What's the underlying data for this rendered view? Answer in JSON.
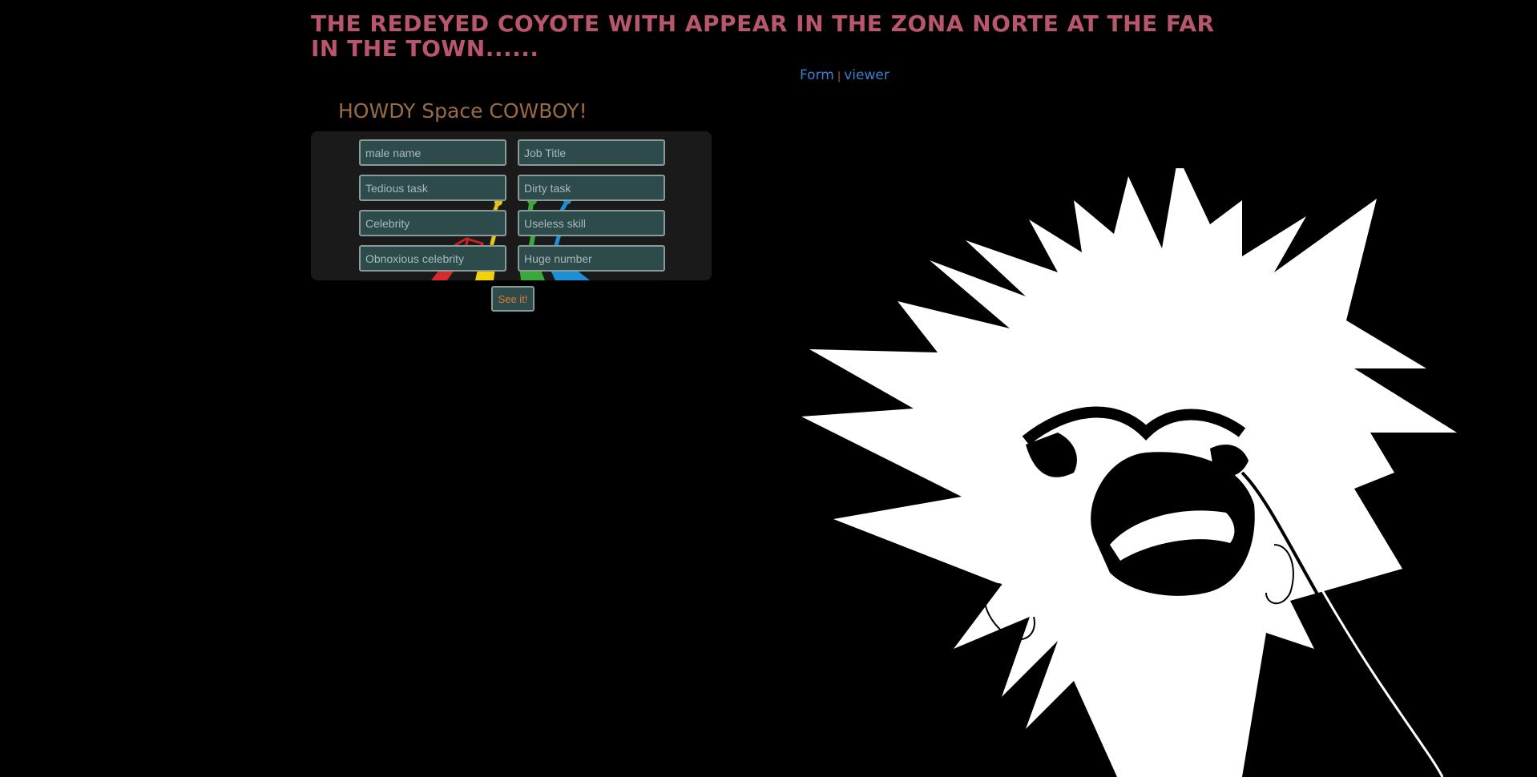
{
  "header": {
    "headline": "THE REDEYED COYOTE WITH APPEAR IN THE ZONA NORTE AT THE FAR IN THE TOWN......"
  },
  "nav": {
    "form_label": "Form",
    "separator": "|",
    "viewer_label": "viewer"
  },
  "main": {
    "greeting": "HOWDY Space COWBOY!"
  },
  "form": {
    "fields": [
      {
        "placeholder": "male name",
        "value": ""
      },
      {
        "placeholder": "Job Title",
        "value": ""
      },
      {
        "placeholder": "Tedious task",
        "value": ""
      },
      {
        "placeholder": "Dirty task",
        "value": ""
      },
      {
        "placeholder": "Celebrity",
        "value": ""
      },
      {
        "placeholder": "Useless skill",
        "value": ""
      },
      {
        "placeholder": "Obnoxious celebrity",
        "value": ""
      },
      {
        "placeholder": "Huge number",
        "value": ""
      }
    ],
    "submit_label": "See it!"
  },
  "icons": {
    "background_art": "rainbow-runners-illustration",
    "hero_art": "spiky-hair-laughing-character-illustration"
  },
  "colors": {
    "background": "#000000",
    "headline": "#b8566b",
    "greeting": "#9a6b45",
    "link": "#3d7fd1",
    "field_bg": "#2e4b4c",
    "field_border": "#8a9a9a",
    "button_text": "#e5782f",
    "panel_bg": "#1a1a1a"
  }
}
